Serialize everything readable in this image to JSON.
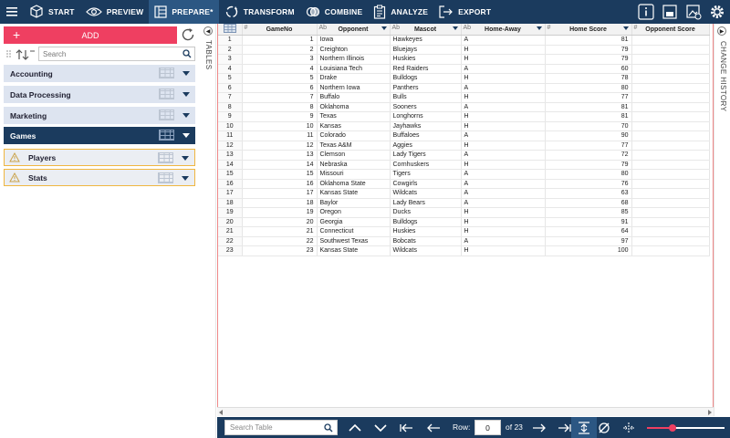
{
  "nav": {
    "items": [
      {
        "label": "START",
        "icon": "cube-icon"
      },
      {
        "label": "PREVIEW",
        "icon": "eye-icon"
      },
      {
        "label": "PREPARE*",
        "icon": "prepare-icon",
        "active": true
      },
      {
        "label": "TRANSFORM",
        "icon": "transform-icon"
      },
      {
        "label": "COMBINE",
        "icon": "combine-icon"
      },
      {
        "label": "ANALYZE",
        "icon": "clipboard-icon"
      },
      {
        "label": "EXPORT",
        "icon": "export-icon"
      }
    ]
  },
  "left": {
    "add_label": "ADD",
    "search_placeholder": "Search",
    "groups": [
      {
        "label": "Accounting"
      },
      {
        "label": "Data Processing"
      },
      {
        "label": "Marketing"
      },
      {
        "label": "Games",
        "active": true
      }
    ],
    "subitems": [
      {
        "label": "Players"
      },
      {
        "label": "Stats"
      }
    ]
  },
  "strips": {
    "tables": "TABLES",
    "history": "CHANGE HISTORY"
  },
  "table": {
    "columns": [
      {
        "label": "",
        "type": ""
      },
      {
        "label": "GameNo",
        "type": "#"
      },
      {
        "label": "Opponent",
        "type": "Ab"
      },
      {
        "label": "Mascot",
        "type": "Ab"
      },
      {
        "label": "Home-Away",
        "type": "Ab"
      },
      {
        "label": "Home Score",
        "type": "#"
      },
      {
        "label": "Opponent Score",
        "type": "#"
      }
    ],
    "rows": [
      [
        "1",
        "1",
        "Iowa",
        "Hawkeyes",
        "A",
        "81",
        ""
      ],
      [
        "2",
        "2",
        "Creighton",
        "Bluejays",
        "H",
        "79",
        ""
      ],
      [
        "3",
        "3",
        "Northern Illinois",
        "Huskies",
        "H",
        "79",
        ""
      ],
      [
        "4",
        "4",
        "Louisiana Tech",
        "Red Raiders",
        "A",
        "60",
        ""
      ],
      [
        "5",
        "5",
        "Drake",
        "Bulldogs",
        "H",
        "78",
        ""
      ],
      [
        "6",
        "6",
        "Northern Iowa",
        "Panthers",
        "A",
        "80",
        ""
      ],
      [
        "7",
        "7",
        "Buffalo",
        "Bulls",
        "H",
        "77",
        ""
      ],
      [
        "8",
        "8",
        "Oklahoma",
        "Sooners",
        "A",
        "81",
        ""
      ],
      [
        "9",
        "9",
        "Texas",
        "Longhorns",
        "H",
        "81",
        ""
      ],
      [
        "10",
        "10",
        "Kansas",
        "Jayhawks",
        "H",
        "70",
        ""
      ],
      [
        "11",
        "11",
        "Colorado",
        "Buffaloes",
        "A",
        "90",
        ""
      ],
      [
        "12",
        "12",
        "Texas A&M",
        "Aggies",
        "H",
        "77",
        ""
      ],
      [
        "13",
        "13",
        "Clemson",
        "Lady Tigers",
        "A",
        "72",
        ""
      ],
      [
        "14",
        "14",
        "Nebraska",
        "Cornhuskers",
        "H",
        "79",
        ""
      ],
      [
        "15",
        "15",
        "Missouri",
        "Tigers",
        "A",
        "80",
        ""
      ],
      [
        "16",
        "16",
        "Oklahoma State",
        "Cowgirls",
        "A",
        "76",
        ""
      ],
      [
        "17",
        "17",
        "Kansas State",
        "Wildcats",
        "A",
        "63",
        ""
      ],
      [
        "18",
        "18",
        "Baylor",
        "Lady Bears",
        "A",
        "68",
        ""
      ],
      [
        "19",
        "19",
        "Oregon",
        "Ducks",
        "H",
        "85",
        ""
      ],
      [
        "20",
        "20",
        "Georgia",
        "Bulldogs",
        "H",
        "91",
        ""
      ],
      [
        "21",
        "21",
        "Connecticut",
        "Huskies",
        "H",
        "64",
        ""
      ],
      [
        "22",
        "22",
        "Southwest Texas",
        "Bobcats",
        "A",
        "97",
        ""
      ],
      [
        "23",
        "23",
        "Kansas State",
        "Wildcats",
        "H",
        "100",
        ""
      ]
    ]
  },
  "bottom": {
    "search_placeholder": "Search Table",
    "row_label": "Row:",
    "row_value": "0",
    "row_total": "of 23",
    "zoom_fraction": 0.33
  },
  "colors": {
    "navy": "#1b3b5e",
    "accent": "#ef3f61",
    "warning": "#f0b640"
  }
}
